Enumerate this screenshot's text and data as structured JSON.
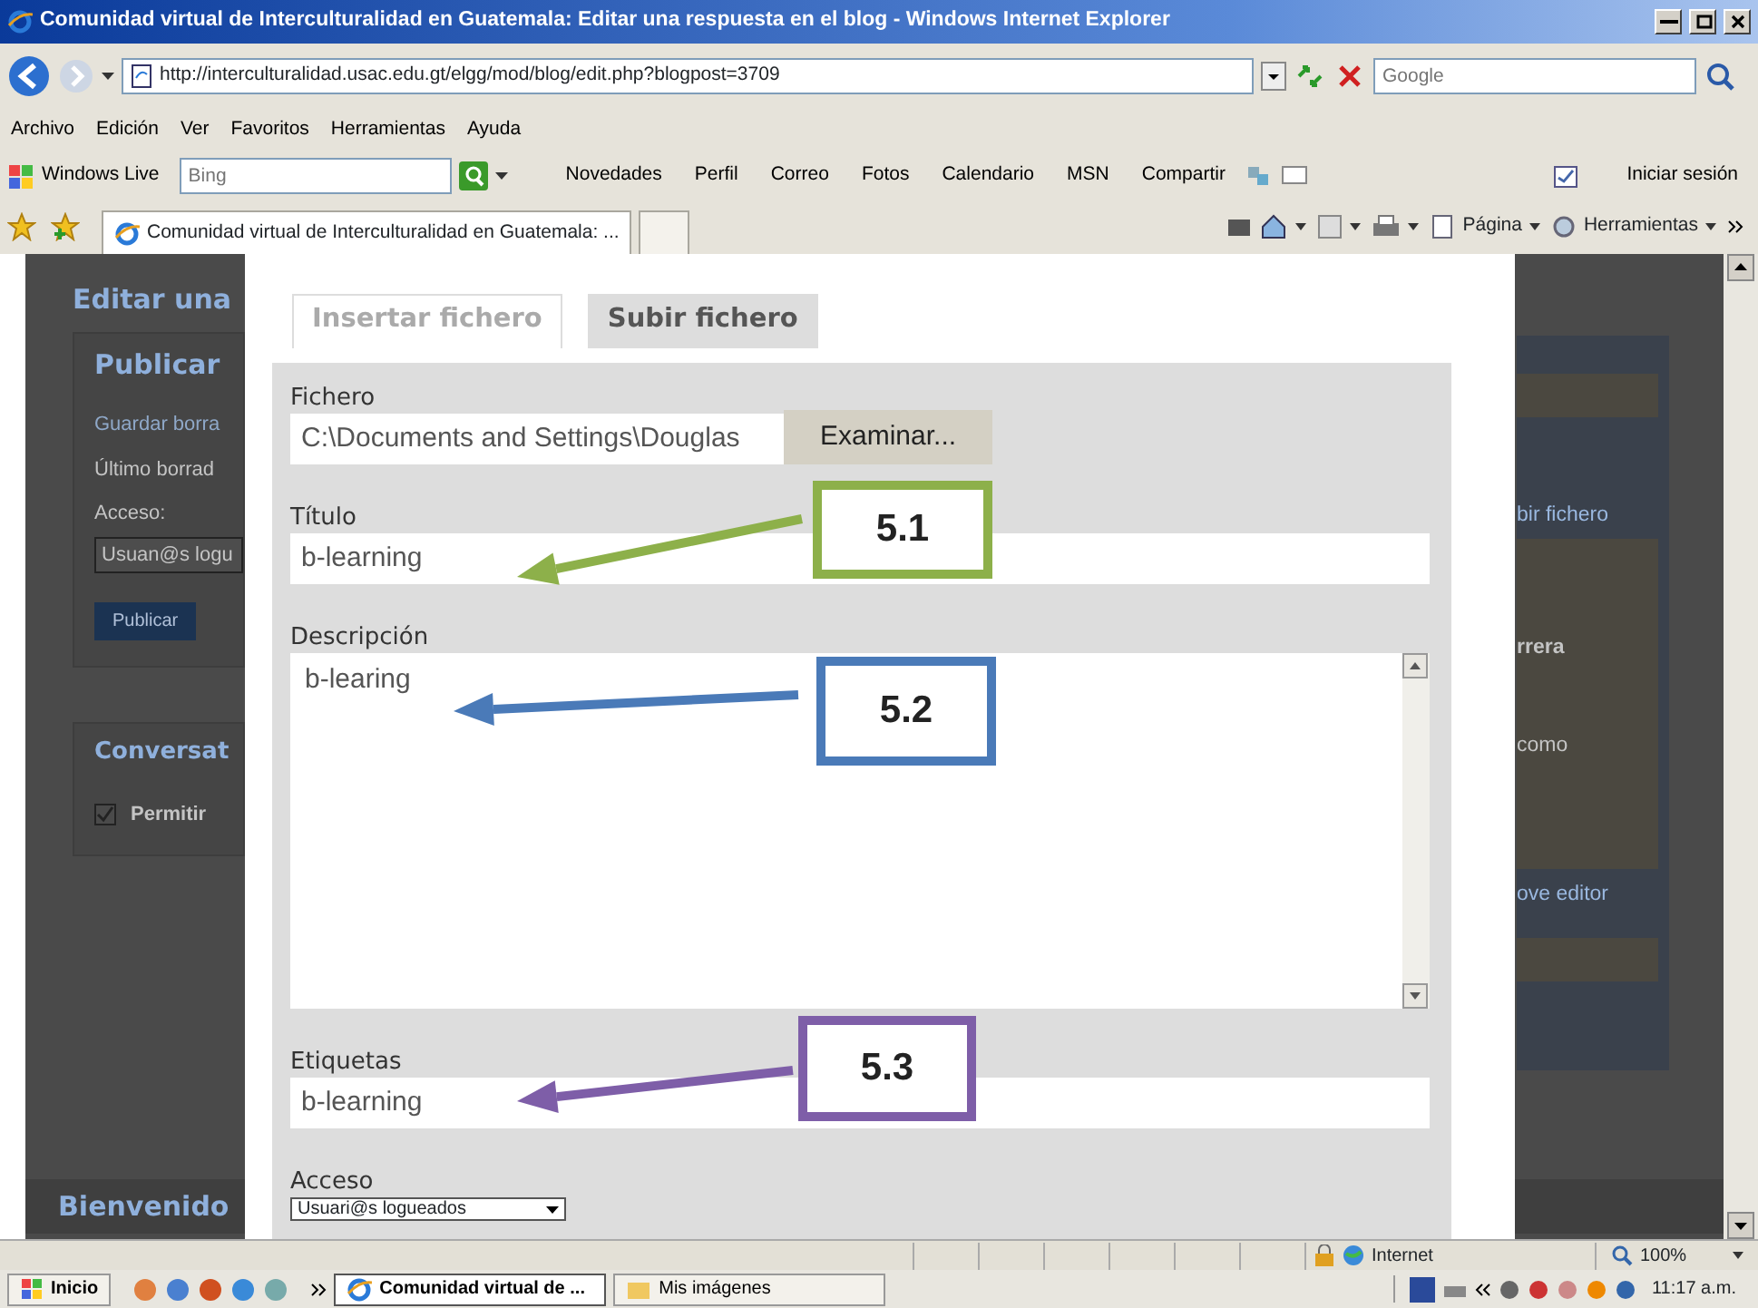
{
  "window": {
    "title": "Comunidad virtual de Interculturalidad en Guatemala: Editar una respuesta en el blog - Windows Internet Explorer"
  },
  "address_bar": {
    "url": "http://interculturalidad.usac.edu.gt/elgg/mod/blog/edit.php?blogpost=3709",
    "search_placeholder": "Google"
  },
  "menu_bar": [
    "Archivo",
    "Edición",
    "Ver",
    "Favoritos",
    "Herramientas",
    "Ayuda"
  ],
  "links_bar": {
    "brand": "Windows Live",
    "search_placeholder": "Bing",
    "links": [
      "Novedades",
      "Perfil",
      "Correo",
      "Fotos",
      "Calendario",
      "MSN",
      "Compartir"
    ],
    "sign_in": "Iniciar sesión"
  },
  "tab_bar": {
    "tabs": [
      {
        "label": "Comunidad virtual de Interculturalidad en Guatemala: ...",
        "selected": true
      }
    ],
    "tools": [
      "Página",
      "Herramientas"
    ]
  },
  "background_page": {
    "heading": "Editar una",
    "publish_panel": {
      "title": "Publicar",
      "save_link": "Guardar borra",
      "last_draft": "Último borrad",
      "access_label": "Acceso:",
      "access_value": "Usuan@s logu",
      "publish_button": "Publicar"
    },
    "conversation_panel": {
      "title": "Conversat",
      "allow": {
        "label": "Permitir",
        "checked": true
      }
    },
    "welcome": "Bienvenido",
    "right_fragments": [
      "bir fichero",
      "rrera",
      "como",
      "ove editor"
    ]
  },
  "dialog": {
    "tabs": [
      {
        "label": "Insertar fichero",
        "selected": true
      },
      {
        "label": "Subir fichero",
        "selected": false
      }
    ],
    "fields": [
      {
        "kind": "file",
        "label": "Fichero",
        "value": "C:\\Documents and Settings\\Douglas",
        "button": "Examinar..."
      },
      {
        "kind": "text",
        "label": "Título",
        "value": "b-learning"
      },
      {
        "kind": "textarea",
        "label": "Descripción",
        "value": "b-learing"
      },
      {
        "kind": "text",
        "label": "Etiquetas",
        "value": "b-learning"
      },
      {
        "kind": "select",
        "label": "Acceso",
        "value": "Usuari@s logueados"
      }
    ]
  },
  "annotations": [
    {
      "label": "5.1",
      "color": "#8db04a"
    },
    {
      "label": "5.2",
      "color": "#4a7ab8"
    },
    {
      "label": "5.3",
      "color": "#7e5ea8"
    }
  ],
  "status_bar": {
    "zone": "Internet",
    "zoom": "100%"
  },
  "taskbar": {
    "start": "Inicio",
    "tasks": [
      {
        "label": "Comunidad virtual de ...",
        "selected": true
      },
      {
        "label": "Mis imágenes",
        "selected": false
      }
    ],
    "clock": "11:17 a.m."
  }
}
